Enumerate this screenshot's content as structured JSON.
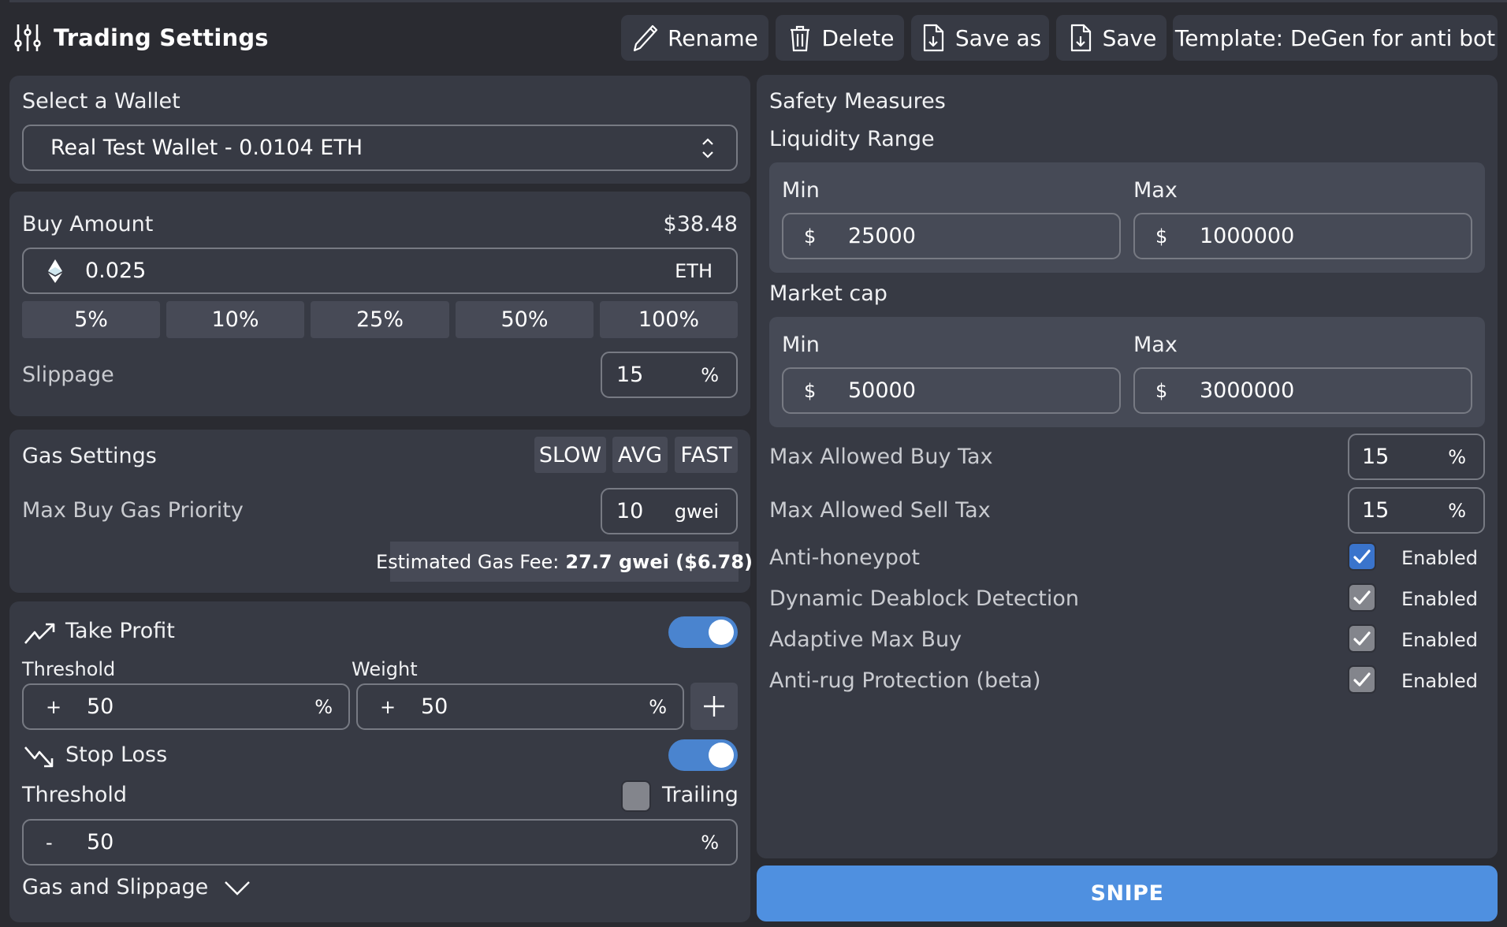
{
  "header": {
    "title": "Trading Settings",
    "buttons": {
      "rename": "Rename",
      "delete": "Delete",
      "save_as": "Save as",
      "save": "Save",
      "template": "Template: DeGen for anti bot"
    }
  },
  "wallet": {
    "label": "Select a Wallet",
    "selected": "Real Test Wallet - 0.0104 ETH"
  },
  "buy": {
    "label": "Buy Amount",
    "usd_value": "$38.48",
    "amount": "0.025",
    "unit": "ETH",
    "presets": [
      "5%",
      "10%",
      "25%",
      "50%",
      "100%"
    ],
    "slippage_label": "Slippage",
    "slippage_value": "15",
    "slippage_unit": "%"
  },
  "gas": {
    "label": "Gas Settings",
    "speeds": [
      "SLOW",
      "AVG",
      "FAST"
    ],
    "priority_label": "Max Buy Gas Priority",
    "priority_value": "10",
    "priority_unit": "gwei",
    "estimate_label": "Estimated Gas Fee:",
    "estimate_value": "27.7 gwei ($6.78)"
  },
  "take_profit": {
    "label": "Take Profit",
    "enabled": true,
    "threshold_label": "Threshold",
    "weight_label": "Weight",
    "threshold_sign": "+",
    "threshold_value": "50",
    "threshold_unit": "%",
    "weight_sign": "+",
    "weight_value": "50",
    "weight_unit": "%"
  },
  "stop_loss": {
    "label": "Stop Loss",
    "enabled": true,
    "threshold_label": "Threshold",
    "trailing_label": "Trailing",
    "trailing_checked": false,
    "threshold_sign": "-",
    "threshold_value": "50",
    "threshold_unit": "%"
  },
  "gas_slippage_toggle": "Gas and Slippage",
  "safety": {
    "title": "Safety Measures",
    "liquidity": {
      "label": "Liquidity Range",
      "min_label": "Min",
      "max_label": "Max",
      "currency": "$",
      "min": "25000",
      "max": "1000000"
    },
    "market_cap": {
      "label": "Market cap",
      "min_label": "Min",
      "max_label": "Max",
      "currency": "$",
      "min": "50000",
      "max": "3000000"
    },
    "buy_tax": {
      "label": "Max Allowed Buy Tax",
      "value": "15",
      "unit": "%"
    },
    "sell_tax": {
      "label": "Max Allowed Sell Tax",
      "value": "15",
      "unit": "%"
    },
    "toggles": [
      {
        "label": "Anti-honeypot",
        "state": "Enabled",
        "checked": true
      },
      {
        "label": "Dynamic Deablock Detection",
        "state": "Enabled",
        "checked": true
      },
      {
        "label": "Adaptive Max Buy",
        "state": "Enabled",
        "checked": true
      },
      {
        "label": "Anti-rug Protection (beta)",
        "state": "Enabled",
        "checked": true
      }
    ]
  },
  "snipe_label": "SNIPE",
  "colors": {
    "accent": "#4f90e0",
    "toggle_on": "#4a84cf",
    "checkbox_active": "#3a74cc",
    "checkbox_disabled": "#83858c",
    "card": "#373a44",
    "background": "#2a2b31"
  }
}
